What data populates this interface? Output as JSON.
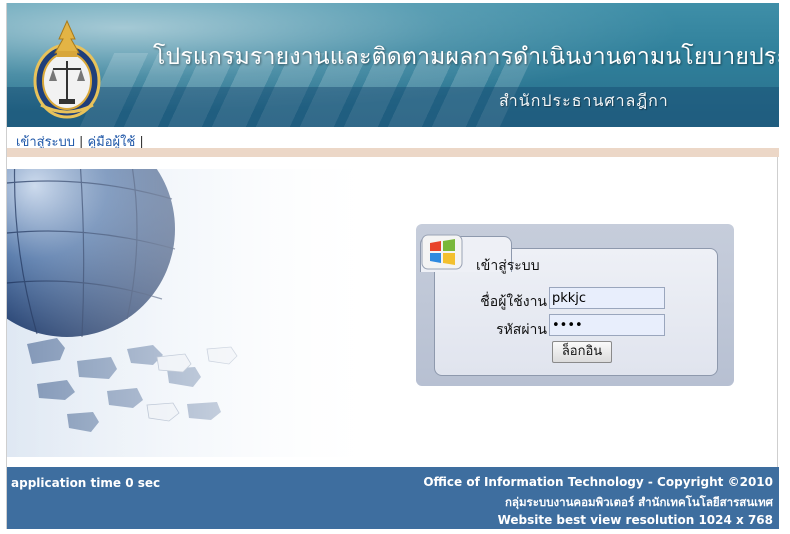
{
  "header": {
    "title": "โปรแกรมรายงานและติดตามผลการดำเนินงานตามนโยบายประธานศาลฎีกา",
    "subtitle": "สำนักประธานศาลฎีกา",
    "seal_icon": "court-seal-icon"
  },
  "nav": {
    "items": [
      {
        "label": "เข้าสู่ระบบ"
      },
      {
        "label": "คู่มือผู้ใช้"
      }
    ],
    "separator": "|"
  },
  "login": {
    "heading": "เข้าสู่ระบบ",
    "username_label": "ชื่อผู้ใช้งาน",
    "username_value": "pkkjc",
    "password_label": "รหัสผ่าน",
    "password_value": "••••",
    "submit_label": "ล็อกอิน",
    "logo_icon": "windows-logo-icon"
  },
  "footer": {
    "app_time": "application time  0 sec",
    "copyright": "Office of Information Technology - Copyright ©2010",
    "department": "กลุ่มระบบงานคอมพิวเตอร์ สำนักเทคโนโลยีสารสนเทศ",
    "best_view": "Website best view resolution 1024 x 768"
  },
  "colors": {
    "banner": "#2f7f9a",
    "nav_link": "#1f57a8",
    "tan_bar": "#ecd7c7",
    "footer": "#3e6e9f",
    "login_panel": "#bfc7d7",
    "input_bg": "#e8eefc"
  }
}
